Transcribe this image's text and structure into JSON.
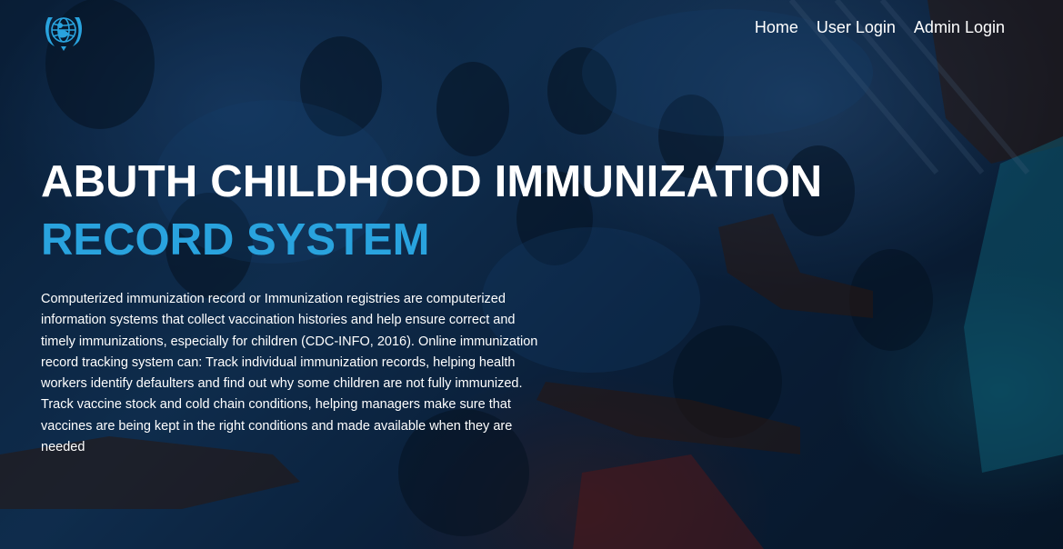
{
  "navbar": {
    "logo": {
      "icon": "unicef-emblem-icon",
      "color": "#29a3de"
    },
    "links": [
      {
        "label": "Home"
      },
      {
        "label": "User Login"
      },
      {
        "label": "Admin Login"
      }
    ]
  },
  "hero": {
    "title_line1": "ABUTH CHILDHOOD IMMUNIZATION",
    "title_line2": "RECORD SYSTEM",
    "description": "Computerized immunization record or Immunization registries are computerized information systems that collect vaccination histories and help ensure correct and timely immunizations, especially for children (CDC-INFO, 2016). Online immunization record tracking system can: Track individual immunization records, helping health workers identify defaulters and find out why some children are not fully immunized. Track vaccine stock and cold chain conditions, helping managers make sure that vaccines are being kept in the right conditions and made available when they are needed",
    "background": "photo of children reaching hands with blue tint",
    "colors": {
      "title_primary": "#ffffff",
      "title_accent": "#29a3de"
    }
  }
}
